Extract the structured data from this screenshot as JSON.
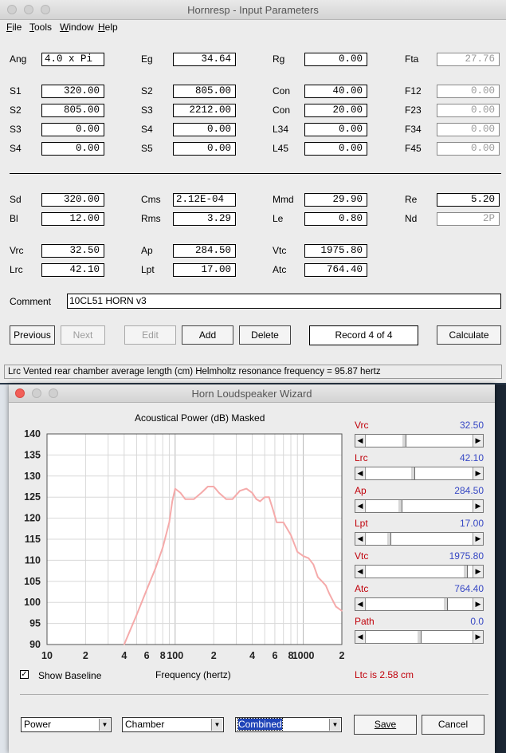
{
  "input_window": {
    "title": "Hornresp - Input Parameters",
    "menu": [
      "File",
      "Tools",
      "Window",
      "Help"
    ],
    "rows": [
      [
        {
          "label": "Ang",
          "value": "4.0 x Pi",
          "style": "left"
        },
        {
          "label": "Eg",
          "value": "34.64"
        },
        {
          "label": "Rg",
          "value": "0.00"
        },
        {
          "label": "Fta",
          "value": "27.76",
          "style": "grey"
        }
      ],
      [
        {
          "label": "S1",
          "value": "320.00"
        },
        {
          "label": "S2",
          "value": "805.00"
        },
        {
          "label": "Con",
          "value": "40.00"
        },
        {
          "label": "F12",
          "value": "0.00",
          "style": "grey"
        }
      ],
      [
        {
          "label": "S2",
          "value": "805.00"
        },
        {
          "label": "S3",
          "value": "2212.00"
        },
        {
          "label": "Con",
          "value": "20.00"
        },
        {
          "label": "F23",
          "value": "0.00",
          "style": "grey"
        }
      ],
      [
        {
          "label": "S3",
          "value": "0.00"
        },
        {
          "label": "S4",
          "value": "0.00"
        },
        {
          "label": "L34",
          "value": "0.00"
        },
        {
          "label": "F34",
          "value": "0.00",
          "style": "grey"
        }
      ],
      [
        {
          "label": "S4",
          "value": "0.00"
        },
        {
          "label": "S5",
          "value": "0.00"
        },
        {
          "label": "L45",
          "value": "0.00"
        },
        {
          "label": "F45",
          "value": "0.00",
          "style": "grey"
        }
      ],
      [
        {
          "label": "Sd",
          "value": "320.00"
        },
        {
          "label": "Cms",
          "value": "2.12E-04",
          "style": "left"
        },
        {
          "label": "Mmd",
          "value": "29.90"
        },
        {
          "label": "Re",
          "value": "5.20"
        }
      ],
      [
        {
          "label": "Bl",
          "value": "12.00"
        },
        {
          "label": "Rms",
          "value": "3.29"
        },
        {
          "label": "Le",
          "value": "0.80"
        },
        {
          "label": "Nd",
          "value": "2P",
          "style": "grey"
        }
      ],
      [
        {
          "label": "Vrc",
          "value": "32.50"
        },
        {
          "label": "Ap",
          "value": "284.50"
        },
        {
          "label": "Vtc",
          "value": "1975.80"
        }
      ],
      [
        {
          "label": "Lrc",
          "value": "42.10"
        },
        {
          "label": "Lpt",
          "value": "17.00"
        },
        {
          "label": "Atc",
          "value": "764.40"
        }
      ]
    ],
    "comment_label": "Comment",
    "comment_value": "10CL51 HORN v3",
    "buttons": {
      "previous": "Previous",
      "next": "Next",
      "edit": "Edit",
      "add": "Add",
      "delete": "Delete",
      "calculate": "Calculate"
    },
    "record": "Record 4 of 4",
    "status": "Lrc  Vented rear chamber average length  (cm)   Helmholtz resonance frequency = 95.87 hertz"
  },
  "wizard": {
    "title": "Horn Loudspeaker Wizard",
    "chart_title": "Acoustical Power (dB)   Masked",
    "x_label": "Frequency (hertz)",
    "show_baseline_label": "Show Baseline",
    "show_baseline_checked": true,
    "ltc_text": "Ltc is 2.58 cm",
    "sliders": [
      {
        "name": "Vrc",
        "value": "32.50",
        "position": 0.35
      },
      {
        "name": "Lrc",
        "value": "42.10",
        "position": 0.44
      },
      {
        "name": "Ap",
        "value": "284.50",
        "position": 0.31
      },
      {
        "name": "Lpt",
        "value": "17.00",
        "position": 0.2
      },
      {
        "name": "Vtc",
        "value": "1975.80",
        "position": 0.95
      },
      {
        "name": "Atc",
        "value": "764.40",
        "position": 0.76
      },
      {
        "name": "Path",
        "value": "0.0",
        "position": 0.5
      }
    ],
    "selects": {
      "mode": "Power",
      "chamber": "Chamber",
      "combined": "Combined"
    },
    "buttons": {
      "save": "Save",
      "cancel": "Cancel"
    },
    "colors": {
      "curve": "#f5aaaa",
      "label_red": "#c0000a",
      "value_blue": "#3647c4",
      "selection": "#1f44b8"
    }
  },
  "chart_data": {
    "type": "line",
    "title": "Acoustical Power (dB)   Masked",
    "xlabel": "Frequency (hertz)",
    "ylabel": "",
    "x_scale": "log",
    "xlim": [
      10,
      2000
    ],
    "ylim": [
      90,
      140
    ],
    "yticks": [
      90,
      95,
      100,
      105,
      110,
      115,
      120,
      125,
      130,
      135,
      140
    ],
    "xtick_labels": [
      {
        "x": 10,
        "label": "10"
      },
      {
        "x": 20,
        "label": "2"
      },
      {
        "x": 40,
        "label": "4"
      },
      {
        "x": 60,
        "label": "6"
      },
      {
        "x": 80,
        "label": "8"
      },
      {
        "x": 100,
        "label": "100"
      },
      {
        "x": 200,
        "label": "2"
      },
      {
        "x": 400,
        "label": "4"
      },
      {
        "x": 600,
        "label": "6"
      },
      {
        "x": 800,
        "label": "8"
      },
      {
        "x": 1000,
        "label": "1000"
      },
      {
        "x": 2000,
        "label": "2"
      }
    ],
    "grid": true,
    "series": [
      {
        "color": "#f5aaaa",
        "x": [
          40,
          50,
          60,
          70,
          80,
          90,
          95,
          100,
          110,
          120,
          140,
          160,
          180,
          200,
          220,
          250,
          280,
          320,
          360,
          400,
          430,
          460,
          500,
          540,
          580,
          620,
          700,
          800,
          900,
          1000,
          1100,
          1200,
          1300,
          1400,
          1500,
          1600,
          1800,
          2000
        ],
        "y": [
          90,
          97,
          103,
          108,
          113,
          119,
          124,
          127,
          126,
          124.5,
          124.5,
          126,
          127.5,
          127.5,
          126,
          124.5,
          124.5,
          126.5,
          127,
          126,
          124.5,
          124,
          125,
          125,
          122,
          119,
          119,
          116,
          112,
          111,
          110.5,
          109,
          106,
          105,
          104,
          102,
          99,
          98
        ]
      }
    ]
  }
}
